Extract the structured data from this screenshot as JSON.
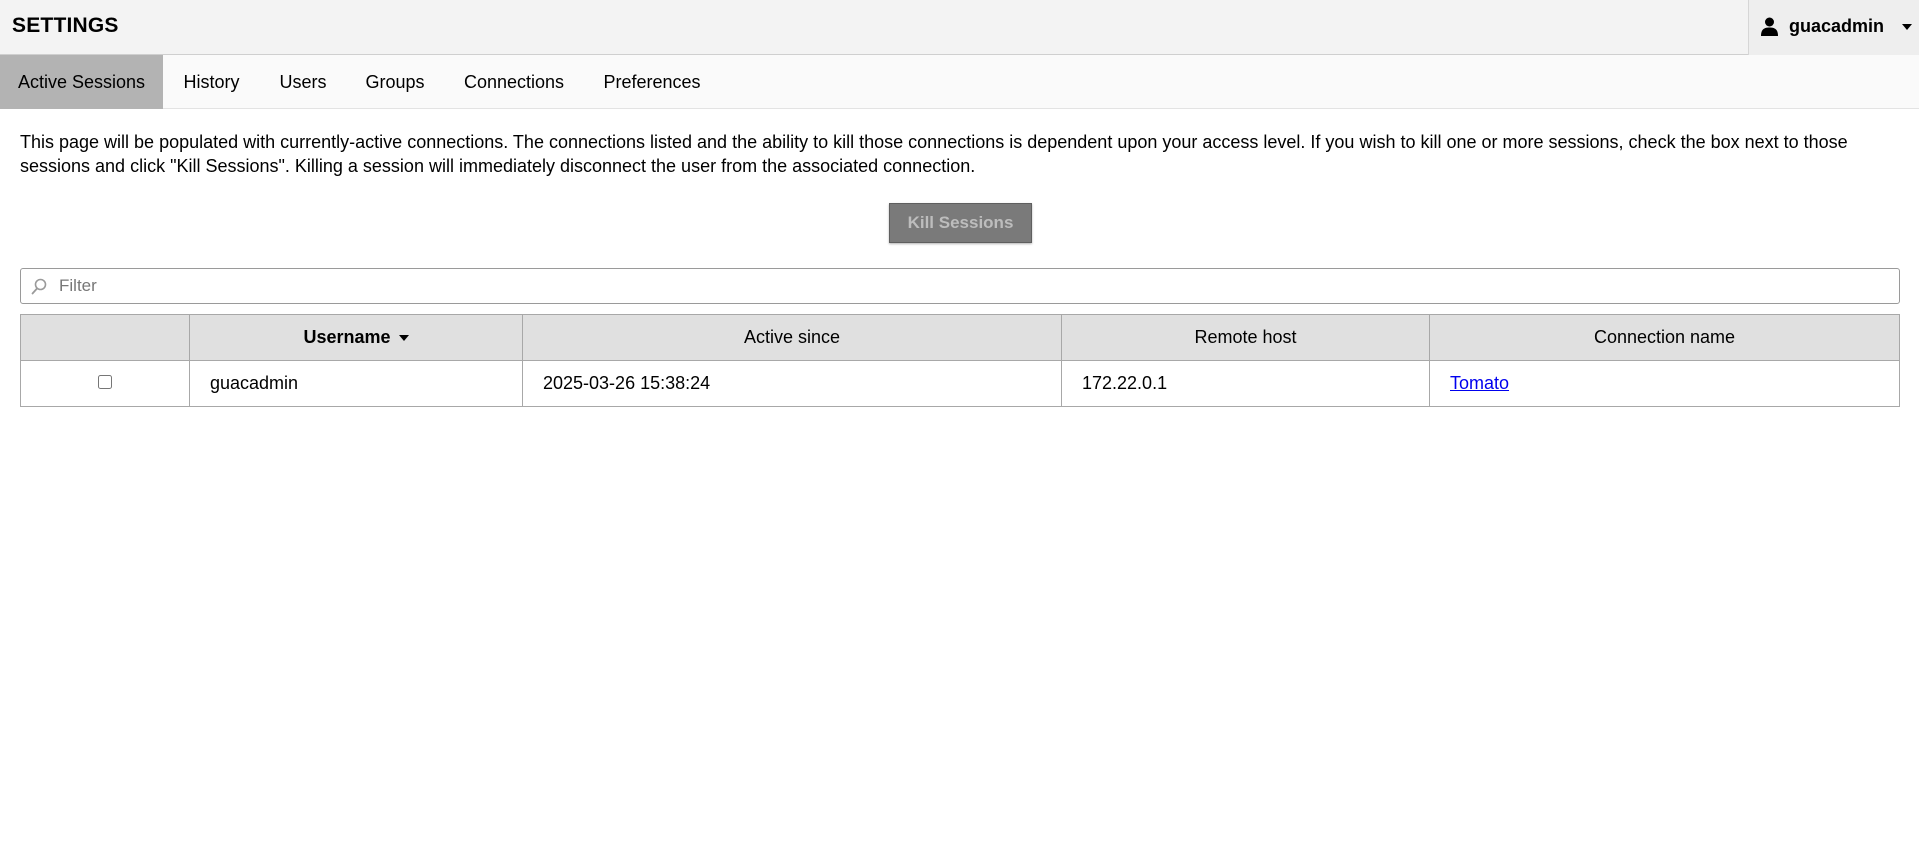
{
  "header": {
    "title": "SETTINGS",
    "user": {
      "icon": "user-icon",
      "name": "guacadmin"
    }
  },
  "tabs": [
    {
      "label": "Active Sessions",
      "active": true
    },
    {
      "label": "History",
      "active": false
    },
    {
      "label": "Users",
      "active": false
    },
    {
      "label": "Groups",
      "active": false
    },
    {
      "label": "Connections",
      "active": false
    },
    {
      "label": "Preferences",
      "active": false
    }
  ],
  "main": {
    "description": "This page will be populated with currently-active connections. The connections listed and the ability to kill those connections is dependent upon your access level. If you wish to kill one or more sessions, check the box next to those sessions and click \"Kill Sessions\". Killing a session will immediately disconnect the user from the associated connection.",
    "kill_button_label": "Kill Sessions",
    "filter": {
      "placeholder": "Filter",
      "value": "",
      "icon": "search-icon"
    },
    "table": {
      "columns": [
        "",
        "Username",
        "Active since",
        "Remote host",
        "Connection name"
      ],
      "sorted_column": "Username",
      "rows": [
        {
          "selected": false,
          "username": "guacadmin",
          "active_since": "2025-03-26 15:38:24",
          "remote_host": "172.22.0.1",
          "connection_name": "Tomato"
        }
      ]
    }
  },
  "colors": {
    "header_bg": "#f3f3f3",
    "active_tab_bg": "#b3b3b3",
    "button_bg": "#7a7a7a",
    "table_header_bg": "#e0e0e0",
    "link": "#0000ee"
  }
}
